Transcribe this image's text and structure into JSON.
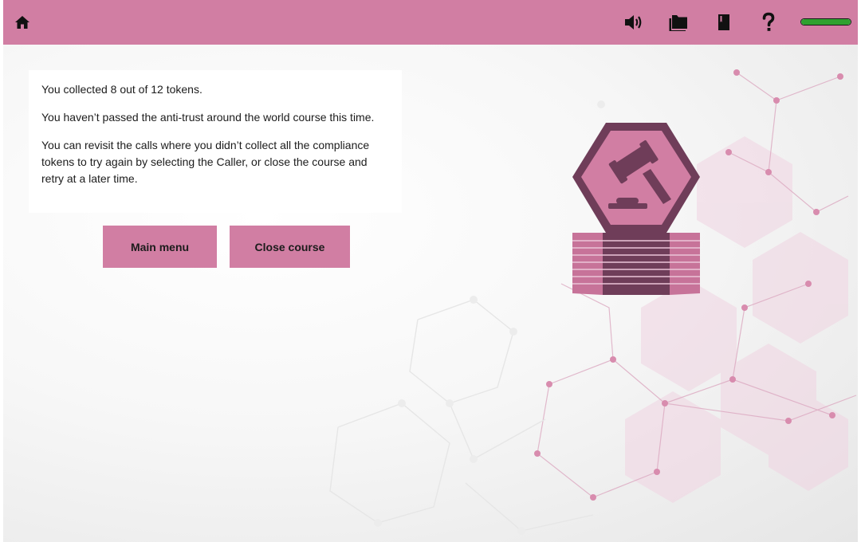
{
  "topbar": {
    "icons": [
      "home-icon",
      "speaker-icon",
      "folder-icon",
      "book-icon",
      "help-icon"
    ],
    "progress": 1.0,
    "colors": {
      "bar": "#d17ea3",
      "progress": "#2fa12f"
    }
  },
  "message": {
    "line1": "You collected 8 out of 12 tokens.",
    "line2": "You haven’t passed the anti-trust around the world course this time.",
    "line3": "You can revisit the calls where you didn’t collect all the compliance tokens to try again by selecting the Caller, or close the course and retry at a later time."
  },
  "buttons": {
    "main_menu": "Main menu",
    "close_course": "Close course"
  },
  "badge": {
    "icon": "gavel-icon",
    "colors": {
      "dark": "#6f3d59",
      "light": "#d17ea3"
    }
  }
}
